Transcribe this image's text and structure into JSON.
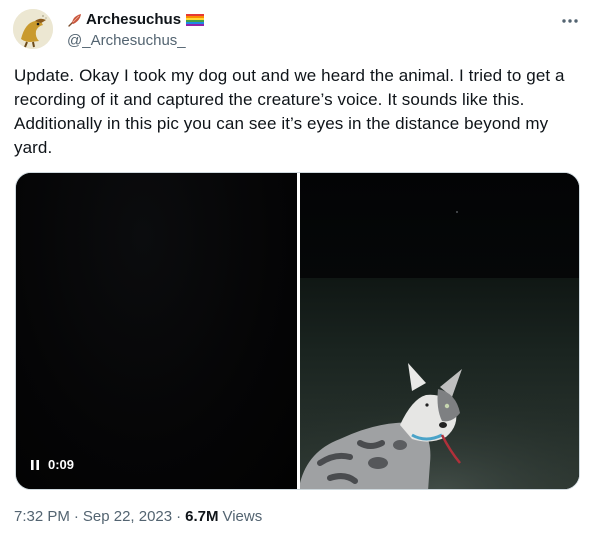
{
  "author": {
    "display_name": "Archesuchus",
    "handle": "@_Archesuchus_",
    "name_emoji_left": "feather-icon",
    "name_emoji_right": "rainbow-flag-icon"
  },
  "tweet": {
    "text": "Update. Okay I took my dog out and we heard the animal. I tried to get a recording of it and captured the creature’s voice. It sounds like this. Additionally in this pic you can see it’s eyes in the distance beyond my yard."
  },
  "media": {
    "video_duration": "0:09",
    "video_state_icon": "pause-icon",
    "panes": [
      "video",
      "photo"
    ]
  },
  "meta": {
    "time": "7:32 PM",
    "date": "Sep 22, 2023",
    "views_count": "6.7M",
    "views_label": "Views"
  },
  "colors": {
    "text_primary": "#0f1419",
    "text_secondary": "#536471",
    "border": "#cfd9de"
  }
}
